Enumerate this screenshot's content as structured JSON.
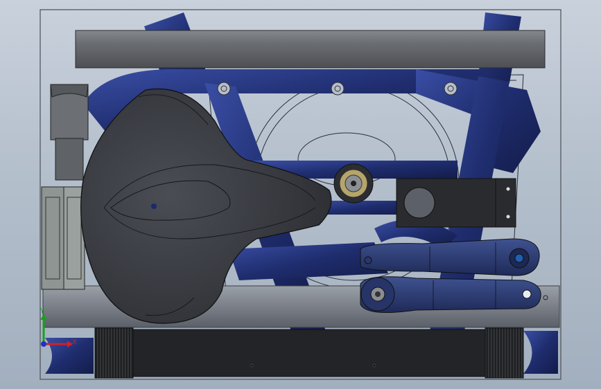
{
  "view": {
    "triad": {
      "x_label": "X",
      "y_label": "Y",
      "x_color": "#d0202a",
      "y_color": "#1aa01a",
      "z_color": "#2030c8"
    }
  },
  "colors": {
    "frame_tube": "#1f2d6e",
    "frame_tube_light": "#33459a",
    "saddle": "#3a3d43",
    "grey_part": "#6c6f73",
    "dark_part": "#26272a",
    "outline": "#111111"
  },
  "icons": [
    "coordinate-triad-icon"
  ]
}
